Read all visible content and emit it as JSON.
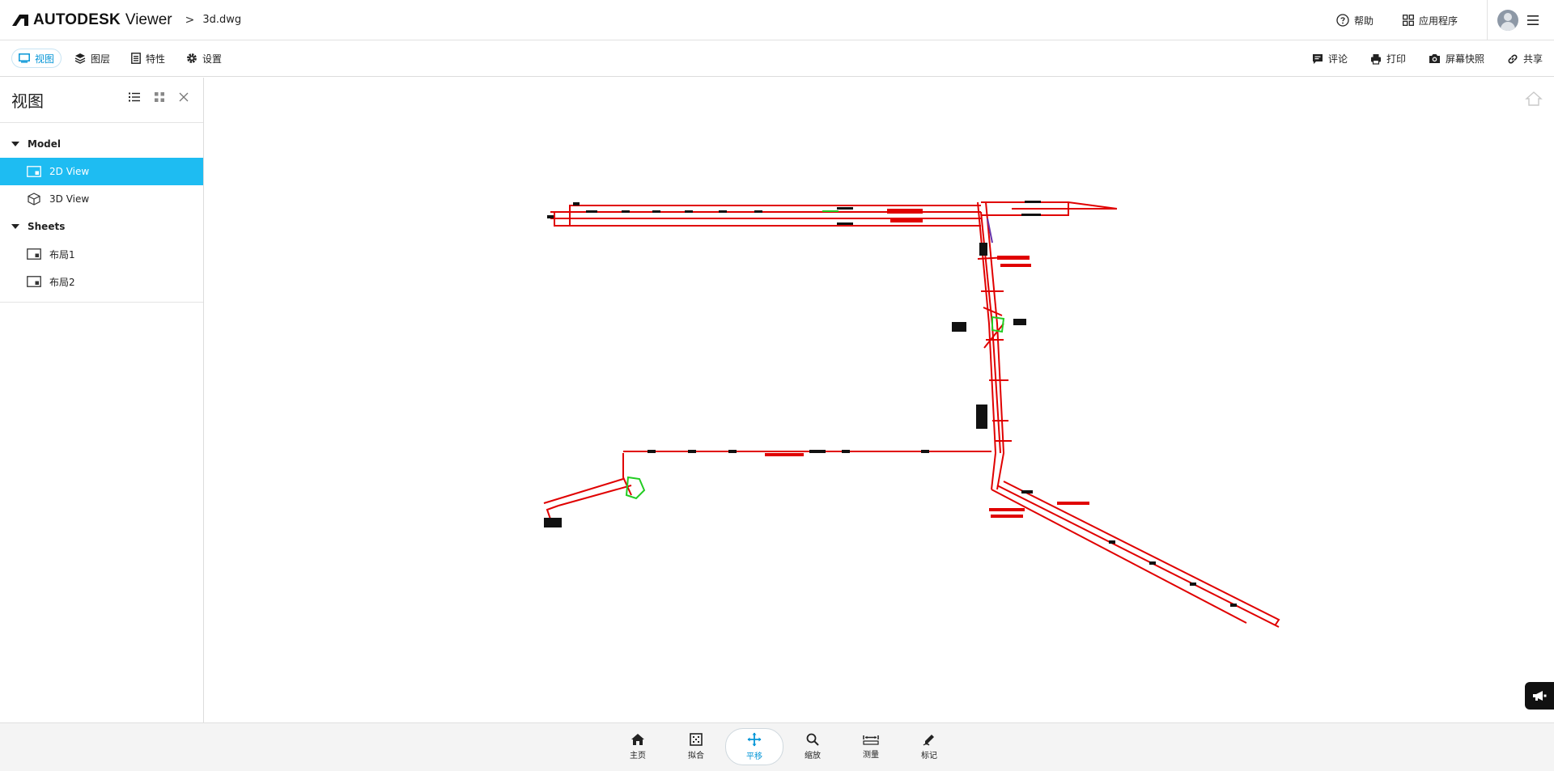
{
  "header": {
    "brand": "AUTODESK",
    "product": "Viewer",
    "breadcrumb_sep": ">",
    "file_name": "3d.dwg",
    "help_label": "帮助",
    "apps_label": "应用程序"
  },
  "toolbar": {
    "tabs": [
      {
        "label": "视图",
        "icon": "monitor-icon",
        "active": true
      },
      {
        "label": "图层",
        "icon": "layers-icon"
      },
      {
        "label": "特性",
        "icon": "properties-icon"
      },
      {
        "label": "设置",
        "icon": "gear-icon"
      }
    ],
    "actions": [
      {
        "label": "评论",
        "icon": "comment-icon"
      },
      {
        "label": "打印",
        "icon": "printer-icon"
      },
      {
        "label": "屏幕快照",
        "icon": "camera-icon"
      },
      {
        "label": "共享",
        "icon": "link-icon"
      }
    ]
  },
  "panel": {
    "title": "视图",
    "groups": [
      {
        "label": "Model",
        "items": [
          {
            "label": "2D View",
            "icon": "sheet-icon",
            "selected": true
          },
          {
            "label": "3D View",
            "icon": "cube-icon"
          }
        ]
      },
      {
        "label": "Sheets",
        "items": [
          {
            "label": "布局1",
            "icon": "sheet-icon"
          },
          {
            "label": "布局2",
            "icon": "sheet-icon"
          }
        ]
      }
    ]
  },
  "bottom_toolbar": [
    {
      "label": "主页",
      "icon": "home-icon"
    },
    {
      "label": "拟合",
      "icon": "fit-icon"
    },
    {
      "label": "平移",
      "icon": "pan-icon",
      "active": true
    },
    {
      "label": "缩放",
      "icon": "zoom-icon"
    },
    {
      "label": "测量",
      "icon": "measure-icon"
    },
    {
      "label": "标记",
      "icon": "markup-icon"
    }
  ],
  "colors": {
    "accent": "#0696d7",
    "selected_row": "#1ebcf2",
    "drawing_line": "#e00000",
    "drawing_highlight": "#22cc22"
  }
}
